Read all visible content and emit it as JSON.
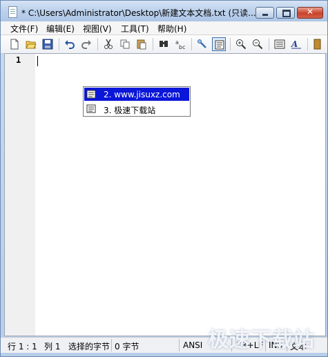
{
  "window": {
    "title": "* C:\\Users\\Administrator\\Desktop\\新建文本文档.txt (只读..."
  },
  "menu": [
    {
      "label": "文件(F)"
    },
    {
      "label": "编辑(E)"
    },
    {
      "label": "视图(V)"
    },
    {
      "label": "工具(T)"
    },
    {
      "label": "帮助(H)"
    }
  ],
  "toolbar": {
    "icons": [
      "new-file-icon",
      "open-folder-icon",
      "save-icon",
      "undo-icon",
      "redo-icon",
      "cut-icon",
      "copy-icon",
      "paste-icon",
      "find-icon",
      "replace-icon",
      "tool-icon",
      "view-toggle-icon",
      "zoom-in-icon",
      "zoom-out-icon",
      "properties-icon",
      "font-icon",
      "exit-icon"
    ]
  },
  "editor": {
    "line_number": "1"
  },
  "popup": {
    "items": [
      {
        "label": "2. www.jisuxz.com",
        "selected": true
      },
      {
        "label": "3. 极速下载站",
        "selected": false
      }
    ]
  },
  "status": {
    "position": "行 1 : 1",
    "column": "列 1",
    "selected": "选择的字节",
    "bytes": "0 字节",
    "encoding": "ANSI",
    "line_ending": "CR+LF",
    "mode": "INS",
    "type": "文本"
  },
  "watermark": "极速下载站"
}
